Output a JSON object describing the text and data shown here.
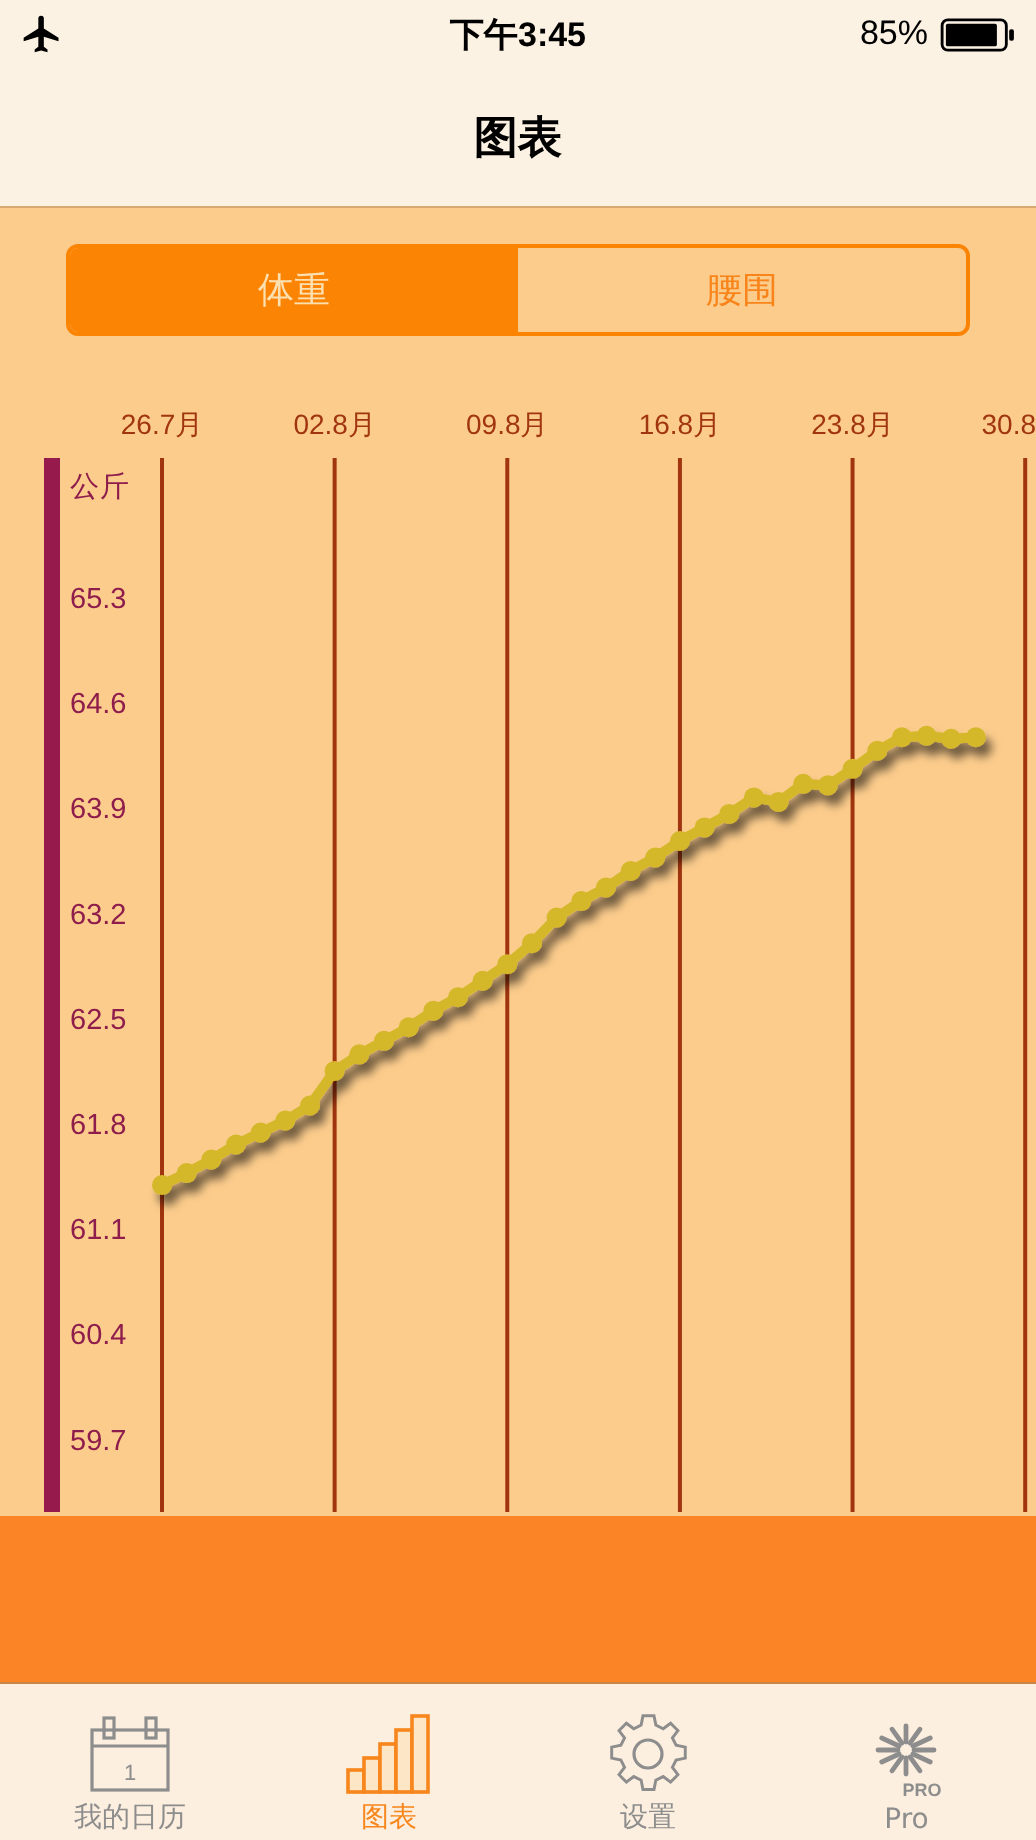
{
  "status_bar": {
    "time": "下午3:45",
    "battery": "85%"
  },
  "nav": {
    "title": "图表"
  },
  "segments": [
    {
      "label": "体重",
      "selected": true
    },
    {
      "label": "腰围",
      "selected": false
    }
  ],
  "chart": {
    "unit": "公斤",
    "chart_data": {
      "type": "line",
      "categories": [
        "26.7月",
        null,
        null,
        null,
        null,
        null,
        null,
        "02.8月",
        null,
        null,
        null,
        null,
        null,
        null,
        "09.8月",
        null,
        null,
        null,
        null,
        null,
        null,
        "16.8月",
        null,
        null,
        null,
        null,
        null,
        null,
        "23.8月",
        null,
        null,
        null,
        null,
        null,
        null,
        "30.8"
      ],
      "grid": true,
      "series": [
        {
          "color": "#d4b82a",
          "marker": "circle",
          "values": [
            61.38,
            61.46,
            61.55,
            61.65,
            61.73,
            61.81,
            61.91,
            62.14,
            62.25,
            62.34,
            62.43,
            62.54,
            62.63,
            62.74,
            62.85,
            62.99,
            63.16,
            63.27,
            63.36,
            63.47,
            63.56,
            63.67,
            63.76,
            63.85,
            63.96,
            63.93,
            64.05,
            64.04,
            64.15,
            64.27,
            64.36,
            64.37,
            64.35,
            64.36,
            null,
            null
          ]
        }
      ],
      "ylim": [
        59.21,
        66.22
      ],
      "yticks": [
        65.3,
        64.6,
        63.9,
        63.2,
        62.5,
        61.8,
        61.1,
        60.4,
        59.7
      ]
    }
  },
  "tab_bar": [
    {
      "kind": "calendar",
      "label": "我的日历",
      "icon_text": "1",
      "selected": false
    },
    {
      "kind": "chart",
      "label": "图表",
      "selected": true
    },
    {
      "kind": "gear",
      "label": "设置",
      "selected": false
    },
    {
      "kind": "pro",
      "label": "Pro",
      "icon_text": "PRO",
      "selected": false
    }
  ]
}
